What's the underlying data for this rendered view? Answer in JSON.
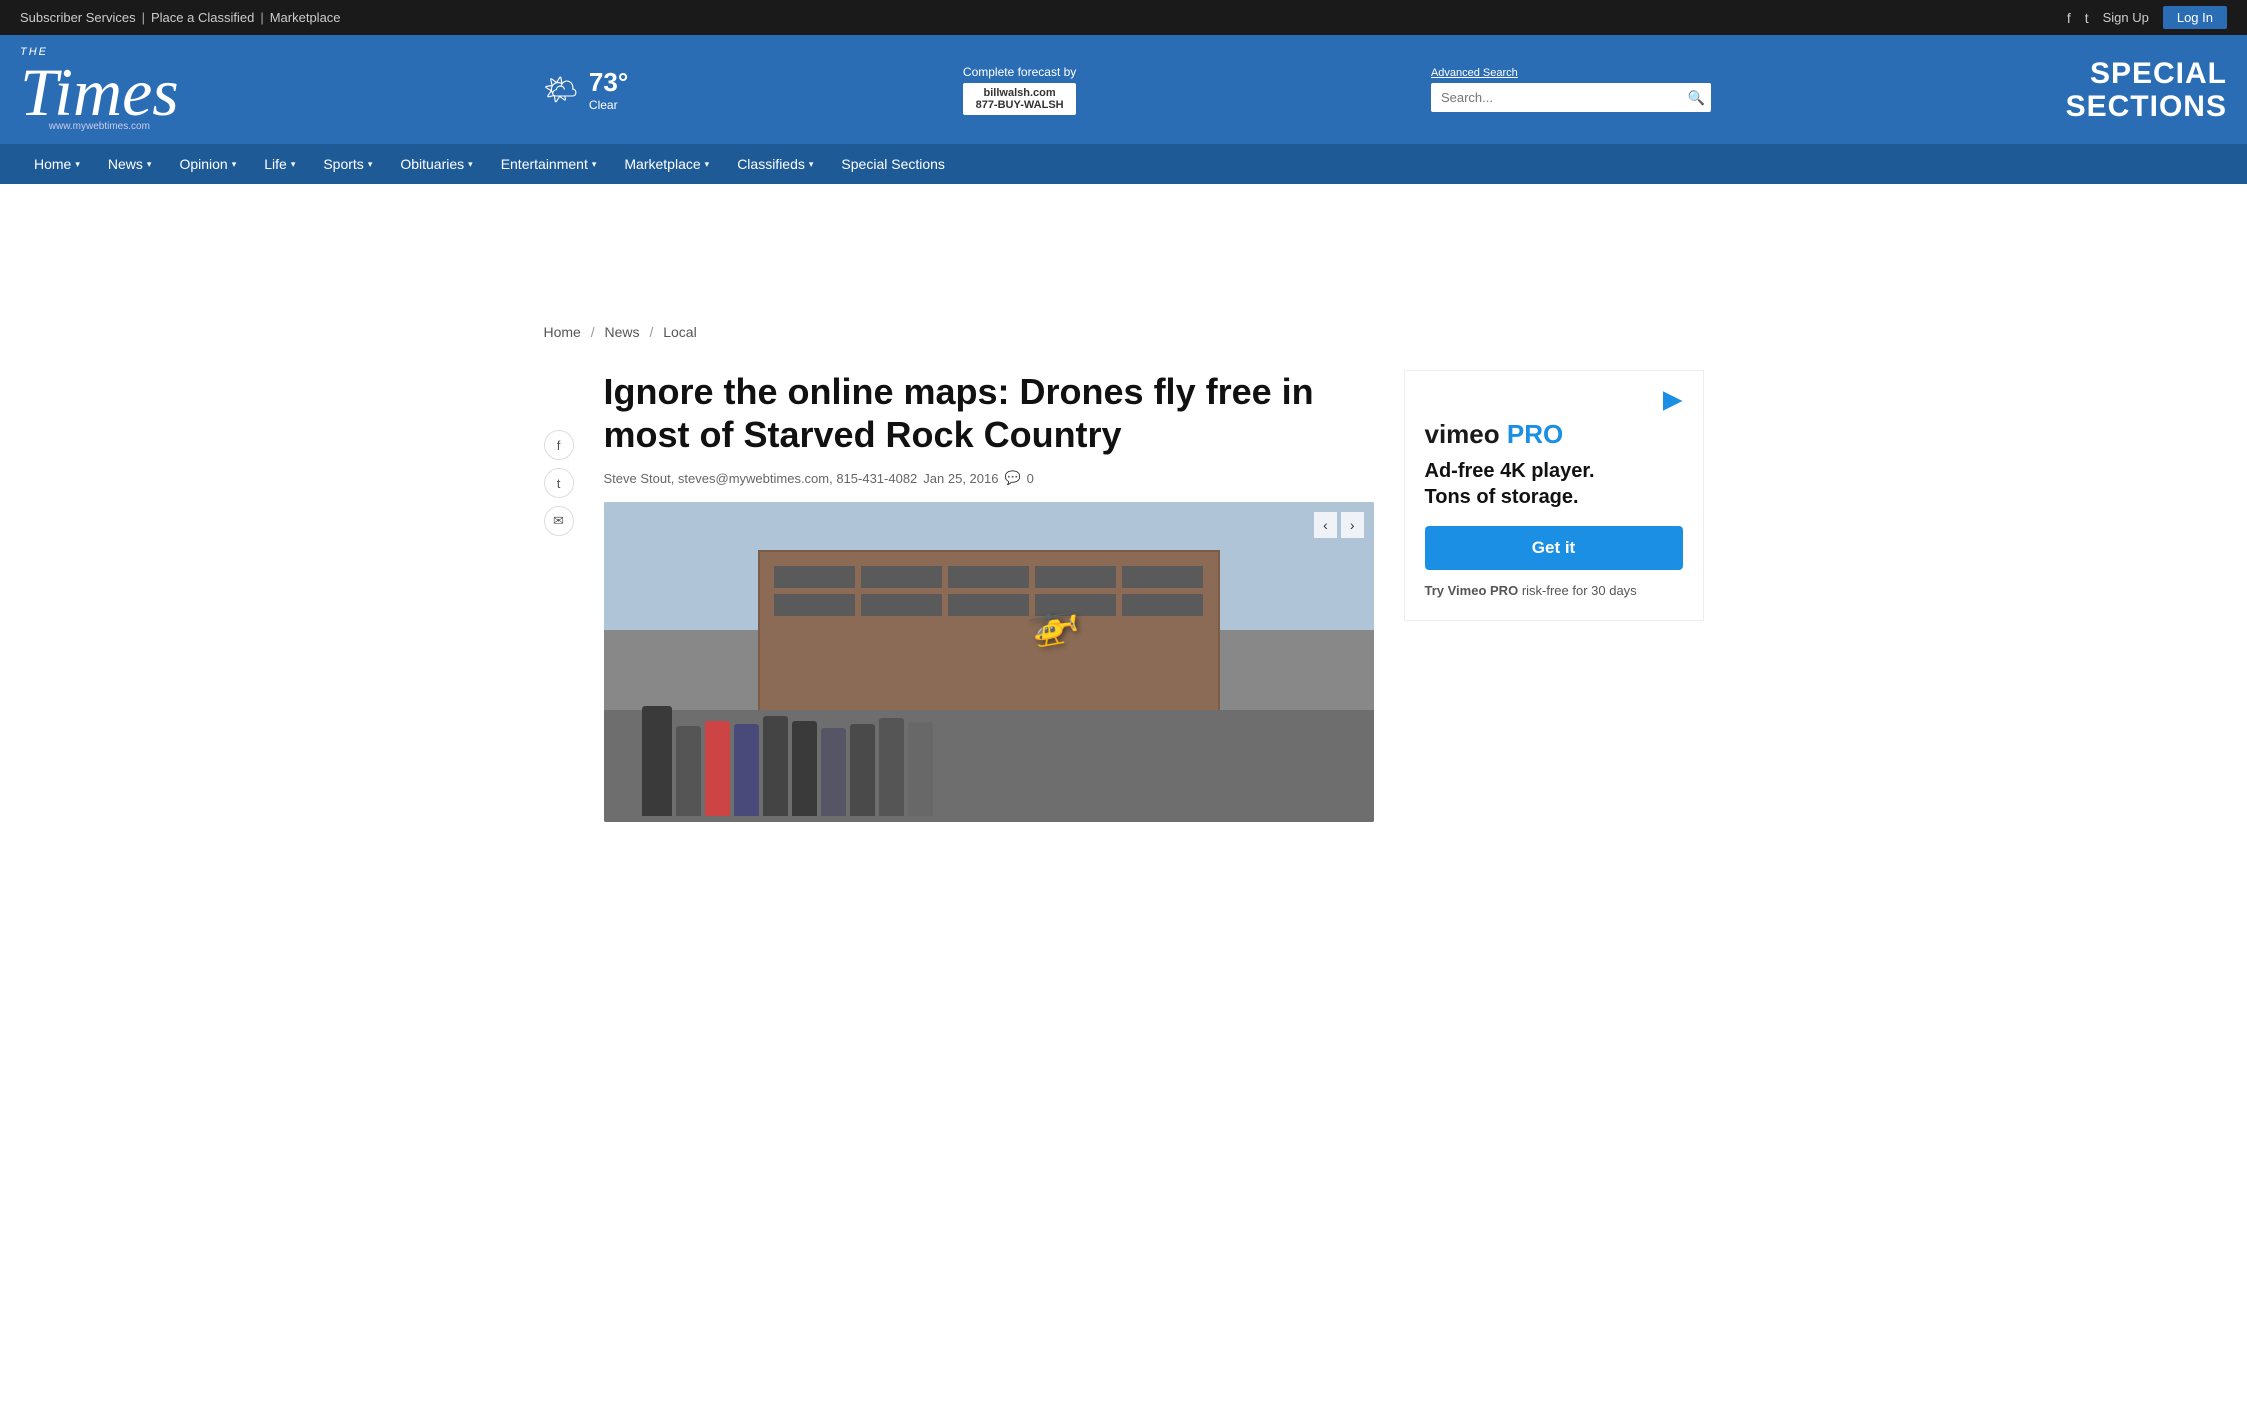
{
  "topbar": {
    "subscriber_services": "Subscriber Services",
    "separator1": "|",
    "place_classified": "Place a Classified",
    "separator2": "|",
    "marketplace": "Marketplace",
    "signup": "Sign Up",
    "login": "Log In",
    "facebook_icon": "f",
    "twitter_icon": "t"
  },
  "header": {
    "logo_the": "THE",
    "logo_times": "Times",
    "logo_website": "www.mywebtimes.com",
    "weather_icon": "🌤",
    "temperature": "73°",
    "weather_desc": "Clear",
    "forecast_label": "Complete forecast by",
    "forecast_site": "billwalsh.com",
    "forecast_phone": "877-BUY-WALSH",
    "advanced_search": "Advanced Search",
    "search_placeholder": "Search...",
    "special_sections_line1": "SPECIAL",
    "special_sections_line2": "SECTIONS"
  },
  "nav": {
    "items": [
      {
        "label": "Home",
        "has_arrow": true
      },
      {
        "label": "News",
        "has_arrow": true
      },
      {
        "label": "Opinion",
        "has_arrow": true
      },
      {
        "label": "Life",
        "has_arrow": true
      },
      {
        "label": "Sports",
        "has_arrow": true
      },
      {
        "label": "Obituaries",
        "has_arrow": true
      },
      {
        "label": "Entertainment",
        "has_arrow": true
      },
      {
        "label": "Marketplace",
        "has_arrow": true
      },
      {
        "label": "Classifieds",
        "has_arrow": true
      },
      {
        "label": "Special Sections",
        "has_arrow": false
      }
    ]
  },
  "breadcrumb": {
    "home": "Home",
    "news": "News",
    "local": "Local"
  },
  "article": {
    "title": "Ignore the online maps: Drones fly free in most of Starved Rock Country",
    "author": "Steve Stout, steves@mywebtimes.com, 815-431-4082",
    "date": "Jan 25, 2016",
    "comments": "0",
    "comment_icon": "💬"
  },
  "social": {
    "facebook": "f",
    "twitter": "t",
    "email": "✉"
  },
  "image": {
    "prev_arrow": "‹",
    "next_arrow": "›"
  },
  "ad": {
    "vimeo": "vimeo",
    "pro": "PRO",
    "tagline_line1": "Ad-free 4K player.",
    "tagline_line2": "Tons of storage.",
    "button_label": "Get it",
    "footer_bold": "Try Vimeo PRO",
    "footer_normal": "risk-free for 30 days"
  }
}
